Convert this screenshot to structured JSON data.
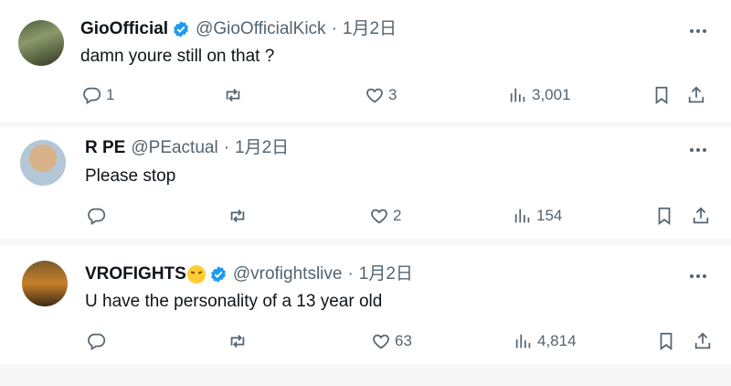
{
  "tweets": [
    {
      "name": "GioOfficial",
      "verified": true,
      "handle": "@GioOfficialKick",
      "separator": "·",
      "date": "1月2日",
      "text": "damn youre still on that ?",
      "replies": "1",
      "retweets": "",
      "likes": "3",
      "views": "3,001",
      "avatar_icon": "profile-photo"
    },
    {
      "name": "R PE",
      "verified": false,
      "handle": "@PEactual",
      "separator": "·",
      "date": "1月2日",
      "text": "Please stop",
      "replies": "",
      "retweets": "",
      "likes": "2",
      "views": "154",
      "avatar_icon": "profile-photo"
    },
    {
      "name": "VROFIGHTS",
      "name_emoji": "steam-face-emoji",
      "verified": true,
      "handle": "@vrofightslive",
      "separator": "·",
      "date": "1月2日",
      "text": "U have the personality of a 13 year old",
      "replies": "",
      "retweets": "",
      "likes": "63",
      "views": "4,814",
      "avatar_icon": "profile-photo"
    }
  ],
  "colors": {
    "text": "#0f1419",
    "secondary": "#536471",
    "verified": "#1d9bf0",
    "separator_bg": "#f7f7f7"
  }
}
